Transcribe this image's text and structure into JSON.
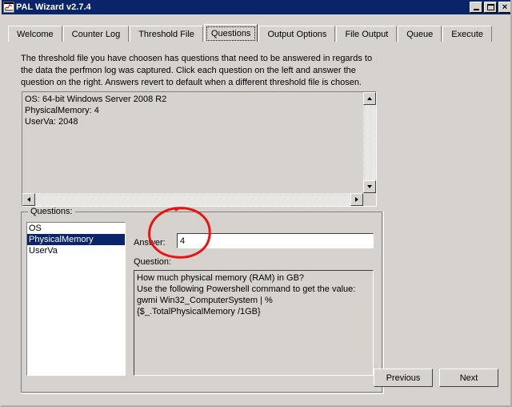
{
  "window": {
    "title": "PAL Wizard v2.7.4",
    "icon": "chart-icon",
    "minimize_label": "Minimize",
    "maximize_label": "Maximize",
    "close_label": "Close",
    "close_glyph": "×"
  },
  "tabs": [
    {
      "label": "Welcome",
      "selected": false
    },
    {
      "label": "Counter Log",
      "selected": false
    },
    {
      "label": "Threshold File",
      "selected": false
    },
    {
      "label": "Questions",
      "selected": true
    },
    {
      "label": "Output Options",
      "selected": false
    },
    {
      "label": "File Output",
      "selected": false
    },
    {
      "label": "Queue",
      "selected": false
    },
    {
      "label": "Execute",
      "selected": false
    }
  ],
  "main": {
    "description": "The threshold file you have choosen has questions that need to be answered in regards to the data the perfmon log was captured. Click each question on the left and answer the question on the right. Answers revert to default when a different threshold file is chosen.",
    "answers_summary": "OS: 64-bit Windows Server 2008 R2\nPhysicalMemory: 4\nUserVa: 2048"
  },
  "questions_group": {
    "legend": "Questions:",
    "items": [
      {
        "label": "OS",
        "selected": false
      },
      {
        "label": "PhysicalMemory",
        "selected": true
      },
      {
        "label": "UserVa",
        "selected": false
      }
    ],
    "answer_label": "Answer:",
    "answer_value": "4",
    "answer_placeholder": "",
    "question_label": "Question:",
    "question_text": "How much physical memory (RAM) in GB?\nUse the following Powershell command to get the value:\ngwmi Win32_ComputerSystem | %\n{$_.TotalPhysicalMemory /1GB}"
  },
  "footer": {
    "previous_label": "Previous",
    "next_label": "Next"
  },
  "annotation": {
    "shape": "ellipse",
    "color": "#ee1111"
  },
  "colors": {
    "titlebar": "#0a246a",
    "window_face": "#d6d3ce",
    "selection": "#0a246a",
    "annotation_red": "#ee1111"
  }
}
